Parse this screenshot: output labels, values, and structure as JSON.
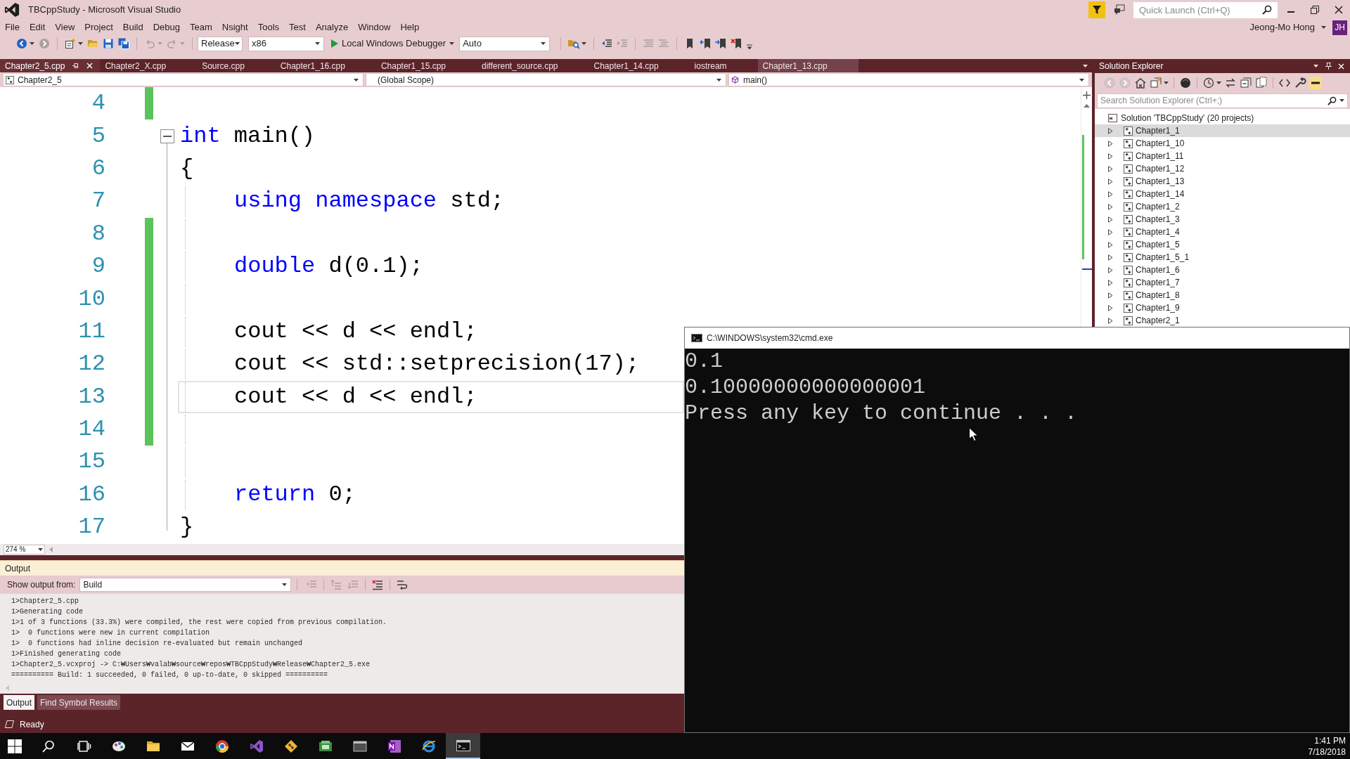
{
  "window": {
    "title": "TBCppStudy - Microsoft Visual Studio",
    "quick_launch": {
      "placeholder": "Quick Launch (Ctrl+Q)"
    },
    "user": {
      "name": "Jeong-Mo Hong",
      "initials": "JH"
    }
  },
  "menu": [
    "File",
    "Edit",
    "View",
    "Project",
    "Build",
    "Debug",
    "Team",
    "Nsight",
    "Tools",
    "Test",
    "Analyze",
    "Window",
    "Help"
  ],
  "toolbar": [
    {
      "kind": "back",
      "disabled": false
    },
    {
      "kind": "forward",
      "disabled": true
    },
    {
      "kind": "separator"
    },
    {
      "kind": "new",
      "disabled": false
    },
    {
      "kind": "open",
      "disabled": false
    },
    {
      "kind": "save",
      "disabled": false
    },
    {
      "kind": "save_all",
      "disabled": false
    },
    {
      "kind": "separator"
    },
    {
      "kind": "undo",
      "disabled": true
    },
    {
      "kind": "redo",
      "disabled": true
    },
    {
      "kind": "separator"
    },
    {
      "kind": "combo",
      "value": "Release"
    },
    {
      "kind": "combo",
      "value": "x86"
    },
    {
      "kind": "run",
      "label": "Local Windows Debugger"
    },
    {
      "kind": "combo",
      "value": "Auto"
    },
    {
      "kind": "separator"
    },
    {
      "kind": "find",
      "disabled": false
    },
    {
      "kind": "separator"
    },
    {
      "kind": "outdent",
      "disabled": false
    },
    {
      "kind": "indent",
      "disabled": true
    },
    {
      "kind": "separator"
    },
    {
      "kind": "comment",
      "disabled": true
    },
    {
      "kind": "uncomment",
      "disabled": true
    },
    {
      "kind": "separator"
    },
    {
      "kind": "bookmark",
      "disabled": false
    },
    {
      "kind": "bookmark_prev",
      "disabled": false
    },
    {
      "kind": "bookmark_next",
      "disabled": false
    },
    {
      "kind": "bookmark_clear",
      "disabled": false
    },
    {
      "kind": "overflow"
    }
  ],
  "document_tabs": [
    {
      "label": "Chapter2_5.cpp",
      "selected": true,
      "hovered": false
    },
    {
      "label": "Chapter2_X.cpp",
      "selected": false,
      "hovered": false
    },
    {
      "label": "Source.cpp",
      "selected": false,
      "hovered": false
    },
    {
      "label": "Chapter1_16.cpp",
      "selected": false,
      "hovered": false
    },
    {
      "label": "Chapter1_15.cpp",
      "selected": false,
      "hovered": false
    },
    {
      "label": "different_source.cpp",
      "selected": false,
      "hovered": false
    },
    {
      "label": "Chapter1_14.cpp",
      "selected": false,
      "hovered": false
    },
    {
      "label": "iostream",
      "selected": false,
      "hovered": false
    },
    {
      "label": "Chapter1_13.cpp",
      "selected": false,
      "hovered": true
    }
  ],
  "navigation": {
    "project": "Chapter2_5",
    "scope": "(Global Scope)",
    "member": "main()"
  },
  "editor": {
    "zoom": "274 %",
    "lines": [
      {
        "number": "4",
        "changed": true,
        "indented": false,
        "current": false
      },
      {
        "number": "5",
        "changed": false,
        "indented": false,
        "current": false,
        "fold_expanded": true,
        "tokens": [
          {
            "kind": "keyword",
            "text": "int"
          },
          {
            "kind": "plain",
            "text": " main()"
          }
        ]
      },
      {
        "number": "6",
        "changed": false,
        "indented": false,
        "current": false,
        "tokens": [
          {
            "kind": "plain",
            "text": "{"
          }
        ]
      },
      {
        "number": "7",
        "changed": false,
        "indented": true,
        "current": false,
        "tokens": [
          {
            "kind": "keyword",
            "text": "using namespace"
          },
          {
            "kind": "plain",
            "text": " std;"
          }
        ]
      },
      {
        "number": "8",
        "changed": true,
        "indented": true,
        "current": false
      },
      {
        "number": "9",
        "changed": true,
        "indented": true,
        "current": false,
        "tokens": [
          {
            "kind": "keyword",
            "text": "double"
          },
          {
            "kind": "plain",
            "text": " d(0.1);"
          }
        ]
      },
      {
        "number": "10",
        "changed": true,
        "indented": true,
        "current": false
      },
      {
        "number": "11",
        "changed": true,
        "indented": true,
        "current": false,
        "tokens": [
          {
            "kind": "plain",
            "text": "cout << d << endl;"
          }
        ]
      },
      {
        "number": "12",
        "changed": true,
        "indented": true,
        "current": false,
        "tokens": [
          {
            "kind": "plain",
            "text": "cout << std::setprecision(17);"
          }
        ]
      },
      {
        "number": "13",
        "changed": true,
        "indented": true,
        "current": true,
        "tokens": [
          {
            "kind": "plain",
            "text": "cout << d << endl;"
          }
        ]
      },
      {
        "number": "14",
        "changed": true,
        "indented": true,
        "current": false
      },
      {
        "number": "15",
        "changed": false,
        "indented": true,
        "current": false
      },
      {
        "number": "16",
        "changed": false,
        "indented": true,
        "current": false,
        "tokens": [
          {
            "kind": "keyword",
            "text": "return"
          },
          {
            "kind": "plain",
            "text": " 0;"
          }
        ]
      },
      {
        "number": "17",
        "changed": false,
        "indented": false,
        "current": false,
        "tokens": [
          {
            "kind": "plain",
            "text": "}"
          }
        ]
      }
    ]
  },
  "output": {
    "title": "Output",
    "source_label": "Show output from:",
    "source": "Build",
    "toolbar": [
      {
        "kind": "goto",
        "disabled": true
      },
      {
        "kind": "separator"
      },
      {
        "kind": "prev",
        "disabled": true
      },
      {
        "kind": "next",
        "disabled": true
      },
      {
        "kind": "separator"
      },
      {
        "kind": "clear",
        "disabled": false
      },
      {
        "kind": "separator"
      },
      {
        "kind": "wrap",
        "disabled": false
      }
    ],
    "lines": [
      "1>Chapter2_5.cpp",
      "1>Generating code",
      "1>1 of 3 functions (33.3%) were compiled, the rest were copied from previous compilation.",
      "1>  0 functions were new in current compilation",
      "1>  0 functions had inline decision re-evaluated but remain unchanged",
      "1>Finished generating code",
      "1>Chapter2_5.vcxproj -> C:₩Users₩valab₩source₩repos₩TBCppStudy₩Release₩Chapter2_5.exe",
      "========== Build: 1 succeeded, 0 failed, 0 up-to-date, 0 skipped =========="
    ]
  },
  "bottom_tabs": [
    {
      "label": "Output",
      "selected": true
    },
    {
      "label": "Find Symbol Results",
      "selected": false
    }
  ],
  "status_bar": {
    "text": "Ready"
  },
  "solution_explorer": {
    "title": "Solution Explorer",
    "toolbar": [
      {
        "kind": "back",
        "disabled": true,
        "on": false
      },
      {
        "kind": "forward",
        "disabled": true,
        "on": false
      },
      {
        "kind": "home",
        "disabled": false,
        "on": false
      },
      {
        "kind": "views",
        "disabled": false,
        "on": false
      },
      {
        "kind": "separator"
      },
      {
        "kind": "sync",
        "disabled": false,
        "on": false
      },
      {
        "kind": "separator"
      },
      {
        "kind": "history",
        "disabled": false,
        "on": false
      },
      {
        "kind": "refresh",
        "disabled": false,
        "on": false
      },
      {
        "kind": "collapse",
        "disabled": false,
        "on": false
      },
      {
        "kind": "show_all",
        "disabled": false,
        "on": false
      },
      {
        "kind": "separator"
      },
      {
        "kind": "code",
        "disabled": false,
        "on": false
      },
      {
        "kind": "properties",
        "disabled": false,
        "on": false
      },
      {
        "kind": "preview",
        "disabled": false,
        "on": true
      }
    ],
    "search": {
      "placeholder": "Search Solution Explorer (Ctrl+;)"
    },
    "tree": [
      {
        "label": "Solution 'TBCppStudy' (20 projects)",
        "children": [
          {
            "label": "Chapter1_1",
            "selected": true,
            "expanded": false
          },
          {
            "label": "Chapter1_10",
            "selected": false,
            "expanded": false
          },
          {
            "label": "Chapter1_11",
            "selected": false,
            "expanded": false
          },
          {
            "label": "Chapter1_12",
            "selected": false,
            "expanded": false
          },
          {
            "label": "Chapter1_13",
            "selected": false,
            "expanded": false
          },
          {
            "label": "Chapter1_14",
            "selected": false,
            "expanded": false
          },
          {
            "label": "Chapter1_2",
            "selected": false,
            "expanded": false
          },
          {
            "label": "Chapter1_3",
            "selected": false,
            "expanded": false
          },
          {
            "label": "Chapter1_4",
            "selected": false,
            "expanded": false
          },
          {
            "label": "Chapter1_5",
            "selected": false,
            "expanded": false
          },
          {
            "label": "Chapter1_5_1",
            "selected": false,
            "expanded": false
          },
          {
            "label": "Chapter1_6",
            "selected": false,
            "expanded": false
          },
          {
            "label": "Chapter1_7",
            "selected": false,
            "expanded": false
          },
          {
            "label": "Chapter1_8",
            "selected": false,
            "expanded": false
          },
          {
            "label": "Chapter1_9",
            "selected": false,
            "expanded": false
          },
          {
            "label": "Chapter2_1",
            "selected": false,
            "expanded": false
          }
        ]
      }
    ]
  },
  "console": {
    "title": "C:\\WINDOWS\\system32\\cmd.exe",
    "lines": [
      "0.1",
      "0.10000000000000001",
      "Press any key to continue . . ."
    ]
  },
  "taskbar": {
    "apps": [
      {
        "kind": "start",
        "active": false
      },
      {
        "kind": "search",
        "active": false
      },
      {
        "kind": "task_view",
        "active": false
      },
      {
        "kind": "paint",
        "active": false
      },
      {
        "kind": "folder",
        "active": false
      },
      {
        "kind": "mail",
        "active": false
      },
      {
        "kind": "browser",
        "active": false
      },
      {
        "kind": "studio",
        "active": false
      },
      {
        "kind": "git",
        "active": false
      },
      {
        "kind": "green_app",
        "active": false
      },
      {
        "kind": "window",
        "active": false
      },
      {
        "kind": "notes",
        "active": false
      },
      {
        "kind": "web",
        "active": false
      },
      {
        "kind": "terminal",
        "active": true
      }
    ],
    "time": "1:41 PM",
    "date": "7/18/2018"
  }
}
